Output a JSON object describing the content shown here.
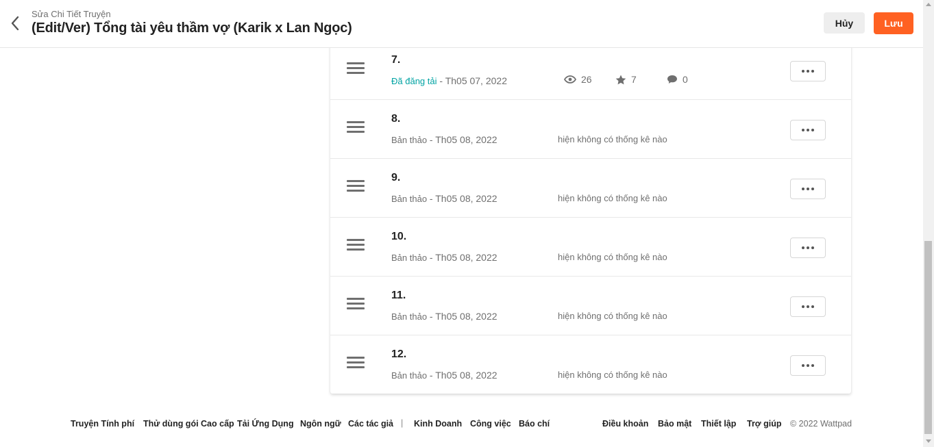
{
  "header": {
    "subtitle": "Sửa Chi Tiết Truyện",
    "title": "(Edit/Ver) Tổng tài yêu thầm vợ (Karik x Lan Ngọc)",
    "cancel_label": "Hủy",
    "save_label": "Lưu"
  },
  "parts": [
    {
      "number": "7.",
      "status": "Đã đăng tải",
      "date": " - Th05 07, 2022",
      "published": true,
      "views": "26",
      "votes": "7",
      "comments": "0"
    },
    {
      "number": "8.",
      "status": "Bản thảo",
      "date": " - Th05 08, 2022",
      "published": false,
      "no_stats": "hiện không có thống kê nào"
    },
    {
      "number": "9.",
      "status": "Bản thảo",
      "date": " - Th05 08, 2022",
      "published": false,
      "no_stats": "hiện không có thống kê nào"
    },
    {
      "number": "10.",
      "status": "Bản thảo",
      "date": " - Th05 08, 2022",
      "published": false,
      "no_stats": "hiện không có thống kê nào"
    },
    {
      "number": "11.",
      "status": "Bản thảo",
      "date": " - Th05 08, 2022",
      "published": false,
      "no_stats": "hiện không có thống kê nào"
    },
    {
      "number": "12.",
      "status": "Bản thảo",
      "date": " - Th05 08, 2022",
      "published": false,
      "no_stats": "hiện không có thống kê nào"
    }
  ],
  "footer": {
    "left_links": [
      "Truyện Tính phí",
      "Thử dùng gói Cao cấp",
      "Tải Ứng Dụng",
      "Ngôn ngữ",
      "Các tác giả"
    ],
    "separator": "|",
    "mid_links": [
      "Kinh Doanh",
      "Công việc",
      "Báo chí"
    ],
    "right_links": [
      "Điều khoản",
      "Bảo mật",
      "Thiết lập",
      "Trợ giúp"
    ],
    "copyright": "© 2022 Wattpad"
  },
  "icons": {
    "back": "chevron-left-icon",
    "drag": "drag-handle-icon",
    "views": "eye-icon",
    "votes": "star-icon",
    "comments": "comment-icon",
    "more": "more-horizontal-icon"
  },
  "colors": {
    "accent": "#ff6122",
    "published": "#00a3a3",
    "muted": "#6f6f6f"
  }
}
